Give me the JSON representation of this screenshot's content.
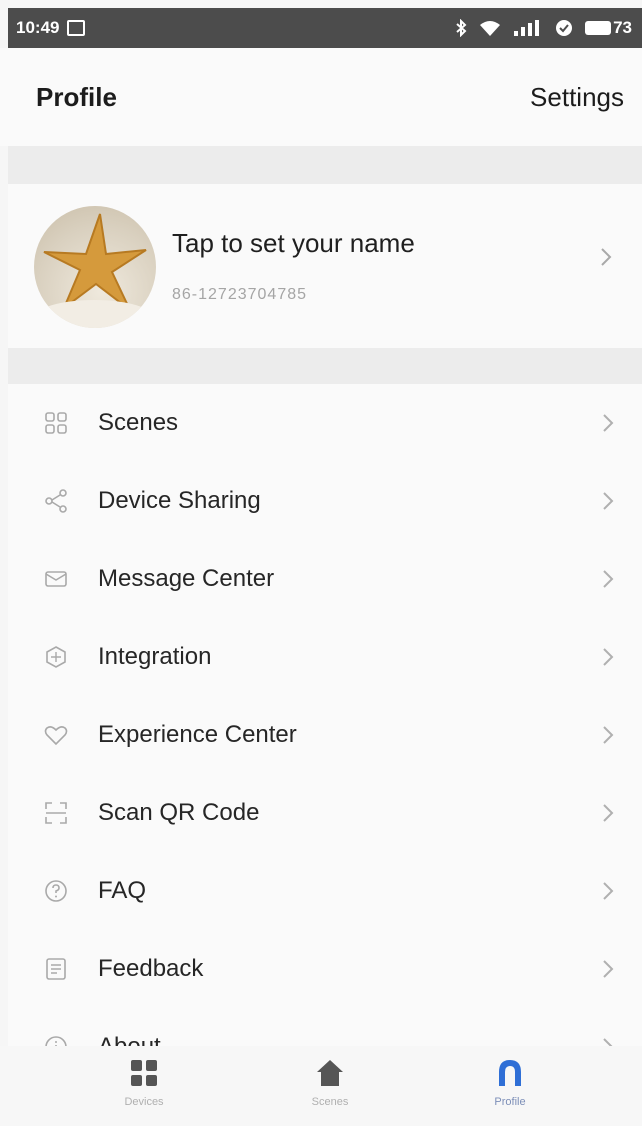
{
  "status_bar": {
    "time": "10:49",
    "battery": "73",
    "icons": [
      "calendar-icon",
      "bluetooth-icon",
      "wifi-icon",
      "signal-icon",
      "sync-icon",
      "battery-icon"
    ]
  },
  "header": {
    "title": "Profile",
    "settings_label": "Settings"
  },
  "profile": {
    "name": "Tap to set your name",
    "phone": "86-12723704785",
    "avatar_icon": "starfish-avatar"
  },
  "menu": {
    "items": [
      {
        "label": "Scenes",
        "icon": "scenes-icon"
      },
      {
        "label": "Device Sharing",
        "icon": "share-icon"
      },
      {
        "label": "Message Center",
        "icon": "message-icon"
      },
      {
        "label": "Integration",
        "icon": "integration-icon"
      },
      {
        "label": "Experience Center",
        "icon": "heart-icon"
      },
      {
        "label": "Scan QR Code",
        "icon": "scan-icon"
      },
      {
        "label": "FAQ",
        "icon": "faq-icon"
      },
      {
        "label": "Feedback",
        "icon": "feedback-icon"
      },
      {
        "label": "About",
        "icon": "info-icon"
      }
    ]
  },
  "tabbar": {
    "tabs": [
      {
        "label": "Devices",
        "icon": "devices-icon"
      },
      {
        "label": "Scenes",
        "icon": "home-icon"
      },
      {
        "label": "Profile",
        "icon": "profile-icon",
        "active": true
      }
    ]
  },
  "colors": {
    "accent": "#2f6fd6",
    "status_bar": "#4c4c4c",
    "section_gap": "#ececec",
    "text_primary": "#262626",
    "text_secondary": "#a5a5a5",
    "icon_gray": "#a9a9a9"
  }
}
